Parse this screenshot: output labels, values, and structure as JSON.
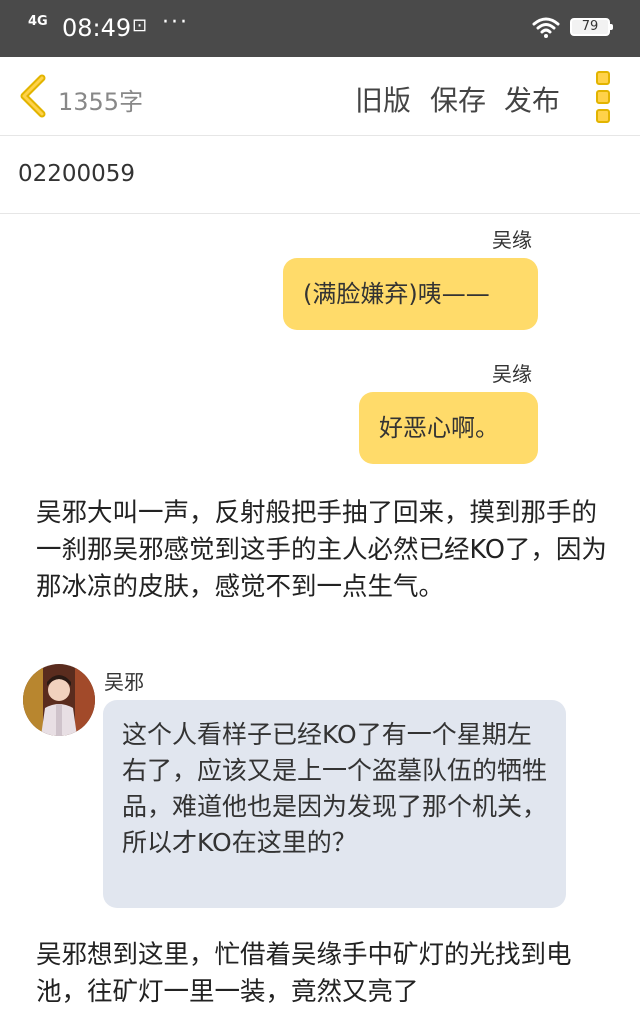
{
  "status_bar": {
    "signal": "4G",
    "time": "08:49",
    "extra_icon": "⊡",
    "more": "···",
    "battery": "79"
  },
  "toolbar": {
    "word_count": "1355字",
    "old_version": "旧版",
    "save": "保存",
    "publish": "发布"
  },
  "doc": {
    "title": "02200059"
  },
  "messages": [
    {
      "speaker": "吴缘",
      "text": "(满脸嫌弃)咦——"
    },
    {
      "speaker": "吴缘",
      "text": "好恶心啊。"
    }
  ],
  "narration": [
    "吴邪大叫一声，反射般把手抽了回来，摸到那手的一刹那吴邪感觉到这手的主人必然已经KO了，因为那冰凉的皮肤，感觉不到一点生气。",
    "吴邪想到这里，忙借着吴缘手中矿灯的光找到电池，往矿灯一里一装，竟然又亮了"
  ],
  "left_message": {
    "speaker": "吴邪",
    "text": "这个人看样子已经KO了有一个星期左右了，应该又是上一个盗墓队伍的牺牲品，难道他也是因为发现了那个机关，所以才KO在这里的？"
  },
  "colors": {
    "status_bg": "#4a4a4a",
    "accent_yellow": "#ffdb6a",
    "left_bubble": "#e1e6ef"
  }
}
